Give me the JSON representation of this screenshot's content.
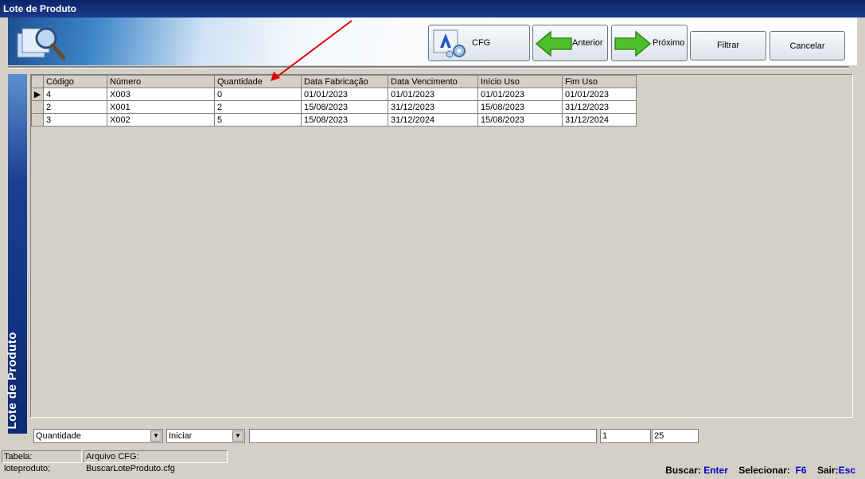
{
  "window": {
    "title": "Lote de Produto"
  },
  "toolbar": {
    "cfg_label": "CFG",
    "prev_label": "Anterior",
    "next_label": "Próximo",
    "filter_label": "Filtrar",
    "cancel_label": "Cancelar"
  },
  "side_label": "Lote de Produto",
  "grid": {
    "columns": [
      "Código",
      "Número",
      "Quantidade",
      "Data Fabricação",
      "Data Vencimento",
      "Início Uso",
      "Fim Uso"
    ],
    "rows": [
      [
        "4",
        "X003",
        "0",
        "01/01/2023",
        "01/01/2023",
        "01/01/2023",
        "01/01/2023"
      ],
      [
        "2",
        "X001",
        "2",
        "15/08/2023",
        "31/12/2023",
        "15/08/2023",
        "31/12/2023"
      ],
      [
        "3",
        "X002",
        "5",
        "15/08/2023",
        "31/12/2024",
        "15/08/2023",
        "31/12/2024"
      ]
    ],
    "current_row_indicator": "▶"
  },
  "search": {
    "field": "Quantidade",
    "mode": "Iniciar",
    "text": "",
    "page": "1",
    "page_size": "25"
  },
  "status": {
    "table": "Tabela: loteproduto;",
    "cfg_file": "Arquivo CFG: BuscarLoteProduto.cfg"
  },
  "hints": {
    "search_label": "Buscar:",
    "search_key": "Enter",
    "select_label": "Selecionar:",
    "select_key": "F6",
    "exit_label": "Sair:",
    "exit_key": "Esc"
  },
  "colors": {
    "title_bar": "#0a246a",
    "side_panel": "#1c3e8f",
    "key_hint": "#0000c0",
    "annotation_arrow": "#e00000"
  }
}
